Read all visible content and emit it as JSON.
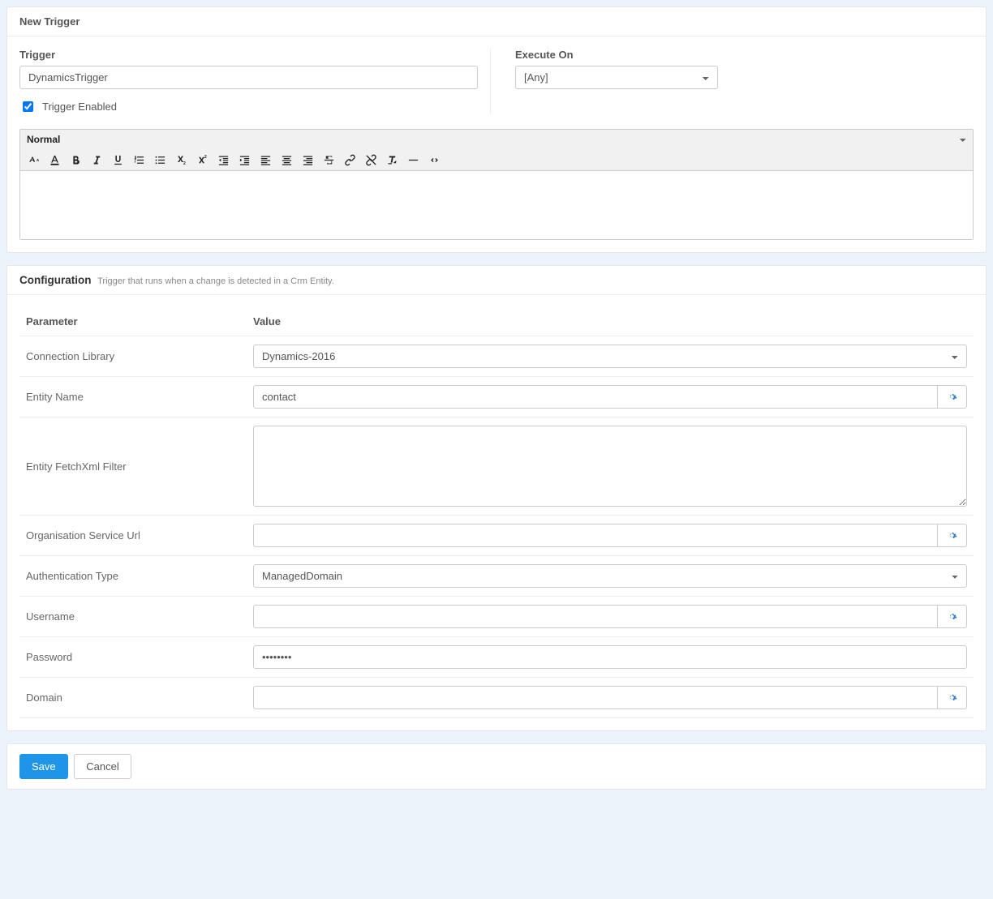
{
  "header": {
    "title": "New Trigger"
  },
  "trigger": {
    "label": "Trigger",
    "value": "DynamicsTrigger",
    "executeOnLabel": "Execute On",
    "executeOnValue": "[Any]",
    "enabledLabel": "Trigger Enabled",
    "enabled": true
  },
  "editor": {
    "formatValue": "Normal",
    "body": ""
  },
  "config": {
    "title": "Configuration",
    "description": "Trigger that runs when a change is detected in a Crm Entity.",
    "columns": {
      "parameter": "Parameter",
      "value": "Value"
    },
    "rows": {
      "connectionLibrary": {
        "label": "Connection Library",
        "value": "Dynamics-2016"
      },
      "entityName": {
        "label": "Entity Name",
        "value": "contact"
      },
      "entityFetchXml": {
        "label": "Entity FetchXml Filter",
        "value": ""
      },
      "orgServiceUrl": {
        "label": "Organisation Service Url",
        "value": ""
      },
      "authType": {
        "label": "Authentication Type",
        "value": "ManagedDomain"
      },
      "username": {
        "label": "Username",
        "value": ""
      },
      "password": {
        "label": "Password",
        "value": "••••••••"
      },
      "domain": {
        "label": "Domain",
        "value": ""
      }
    }
  },
  "footer": {
    "save": "Save",
    "cancel": "Cancel"
  }
}
